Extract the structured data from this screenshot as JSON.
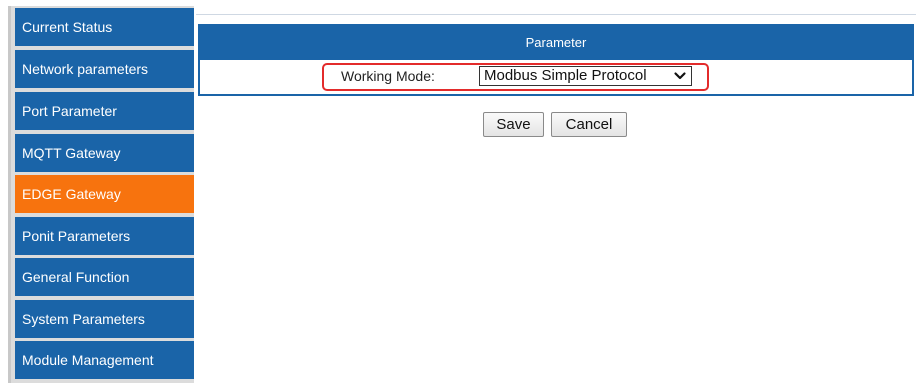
{
  "sidebar": {
    "items": [
      {
        "label": "Current Status",
        "active": false
      },
      {
        "label": "Network parameters",
        "active": false
      },
      {
        "label": "Port Parameter",
        "active": false
      },
      {
        "label": "MQTT Gateway",
        "active": false
      },
      {
        "label": "EDGE Gateway",
        "active": true
      },
      {
        "label": "Ponit Parameters",
        "active": false
      },
      {
        "label": "General Function",
        "active": false
      },
      {
        "label": "System Parameters",
        "active": false
      },
      {
        "label": "Module Management",
        "active": false
      }
    ]
  },
  "panel": {
    "title": "Parameter",
    "working_mode_label": "Working Mode:",
    "working_mode_value": "Modbus Simple Protocol"
  },
  "buttons": {
    "save_label": "Save",
    "cancel_label": "Cancel"
  },
  "colors": {
    "nav_blue": "#1a64a8",
    "nav_active": "#f7730e",
    "highlight_red": "#e32b2b"
  }
}
